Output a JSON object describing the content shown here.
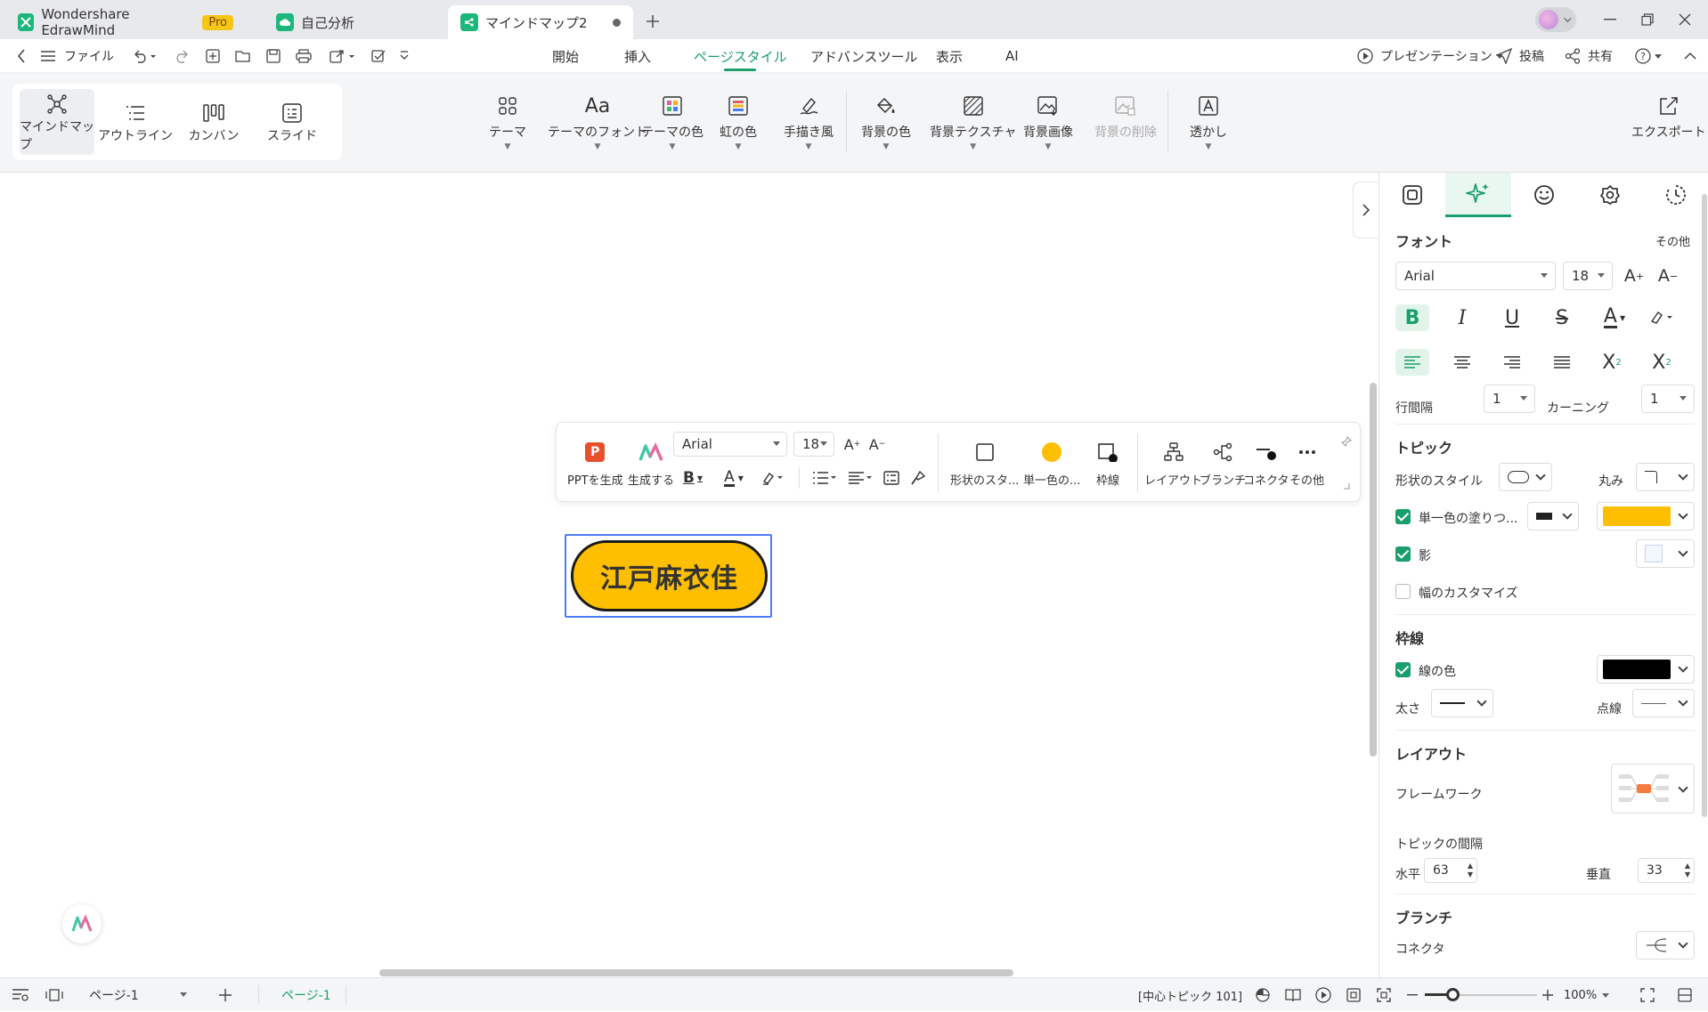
{
  "tabs": [
    {
      "label": "Wondershare EdrawMind",
      "badge": "Pro"
    },
    {
      "label": "自己分析"
    },
    {
      "label": "マインドマップ2"
    }
  ],
  "menubar": {
    "file": "ファイル",
    "tabs": [
      "開始",
      "挿入",
      "ページスタイル",
      "アドバンスツール",
      "表示",
      "AI"
    ],
    "active_tab": "ページスタイル",
    "present": "プレゼンテーション",
    "post": "投稿",
    "share": "共有"
  },
  "views": [
    "マインドマップ",
    "アウトライン",
    "カンバン",
    "スライド"
  ],
  "ribbon": {
    "theme": "テーマ",
    "theme_font": "テーマのフォント",
    "theme_color": "テーマの色",
    "rainbow": "虹の色",
    "handdrawn": "手描き風",
    "bg_color": "背景の色",
    "bg_texture": "背景テクスチャ",
    "bg_image": "背景画像",
    "bg_remove": "背景の削除",
    "watermark": "透かし",
    "export": "エクスポート"
  },
  "float_toolbar": {
    "ppt": "PPTを生成",
    "generate": "生成する",
    "font": "Arial",
    "size": "18",
    "shape": "形状のスタ...",
    "fill": "単一色の...",
    "border": "枠線",
    "layout": "レイアウト",
    "branch": "ブランチ",
    "connector": "コネクタ",
    "more": "その他"
  },
  "node": {
    "text": "江戸麻衣佳",
    "fill": "#fdbf00"
  },
  "panel": {
    "font_header": "フォント",
    "font_more": "その他",
    "font": "Arial",
    "size": "18",
    "line_spacing_label": "行間隔",
    "line_spacing": "1",
    "kerning_label": "カーニング",
    "kerning": "1",
    "topic_header": "トピック",
    "shape_style": "形状のスタイル",
    "corner": "丸み",
    "fill_label": "単一色の塗りつ...",
    "shadow": "影",
    "custom_width": "幅のカスタマイズ",
    "border_header": "枠線",
    "line_color": "線の色",
    "thickness": "太さ",
    "dashed": "点線",
    "layout_header": "レイアウト",
    "framework": "フレームワーク",
    "spacing": "トピックの間隔",
    "horizontal_label": "水平",
    "horizontal": "63",
    "vertical_label": "垂直",
    "vertical": "33",
    "branch_header": "ブランチ",
    "connector": "コネクタ"
  },
  "status": {
    "page_select": "ページ-1",
    "page_tab": "ページ-1",
    "info": "[中心トピック 101]",
    "zoom": "100%"
  },
  "colors": {
    "accent": "#1a9e6b",
    "node_fill": "#fdbf00",
    "selection": "#4f7cf7"
  }
}
